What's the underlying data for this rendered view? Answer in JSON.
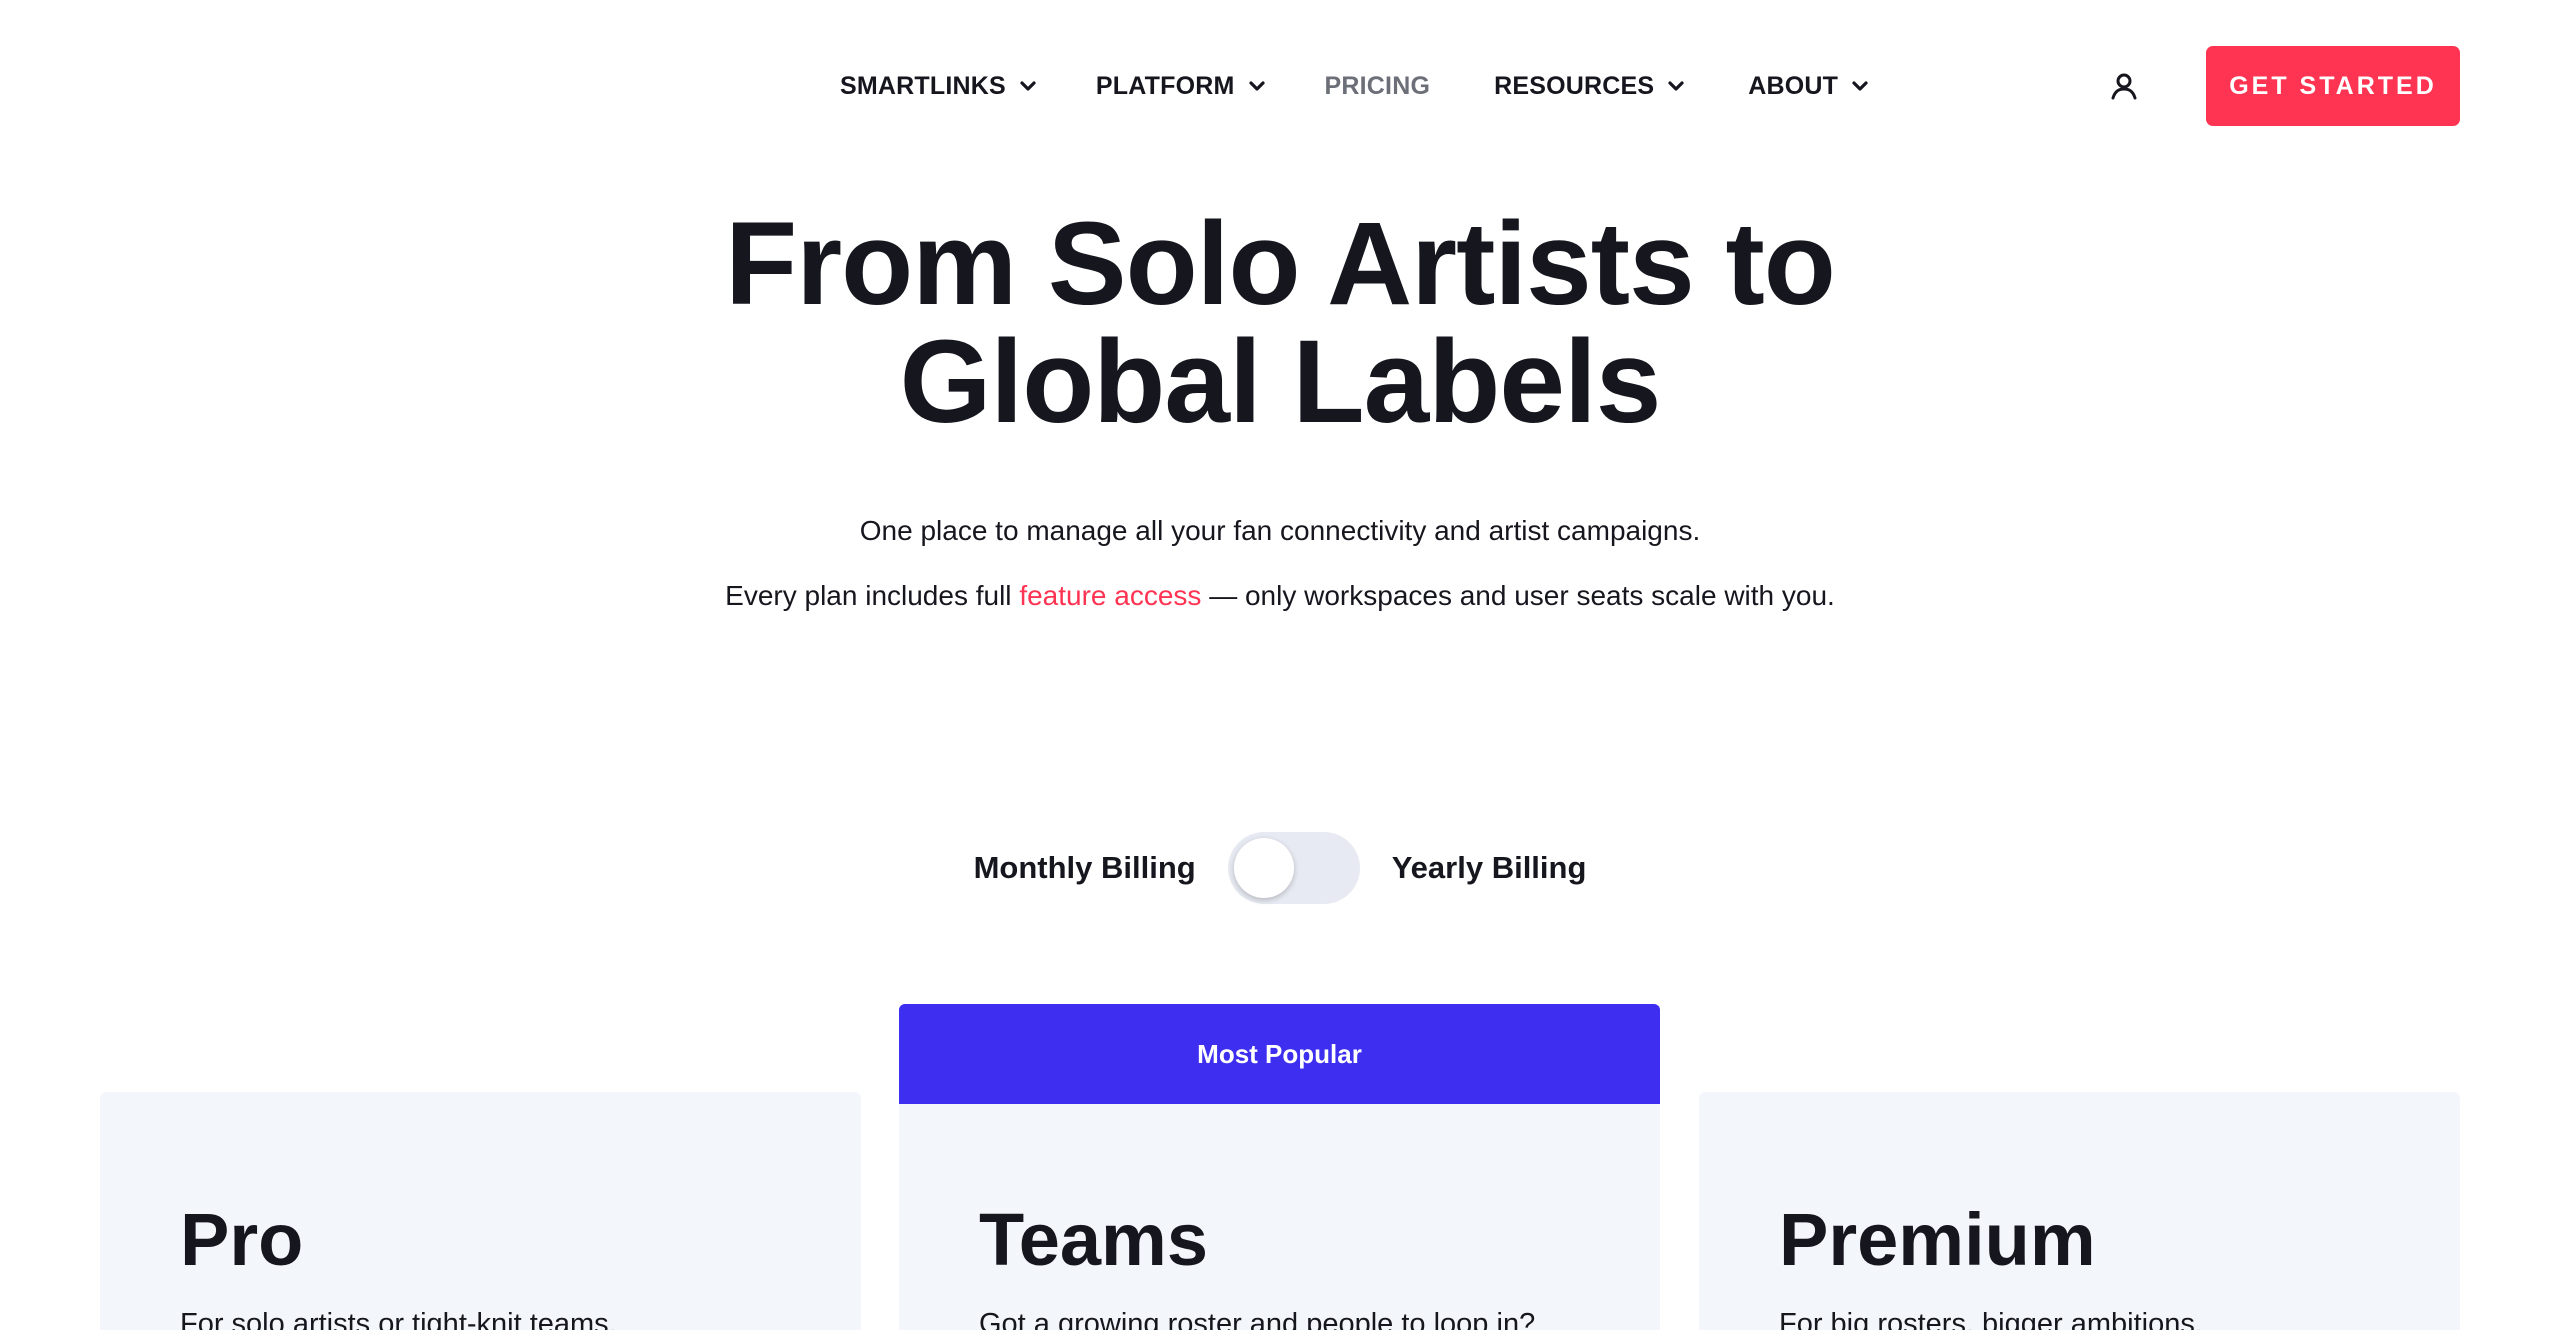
{
  "nav": {
    "items": [
      {
        "label": "SMARTLINKS",
        "has_dropdown": true
      },
      {
        "label": "PLATFORM",
        "has_dropdown": true
      },
      {
        "label": "PRICING",
        "has_dropdown": false,
        "active": true
      },
      {
        "label": "RESOURCES",
        "has_dropdown": true
      },
      {
        "label": "ABOUT",
        "has_dropdown": true
      }
    ],
    "user_icon": "user-icon",
    "cta_label": "GET STARTED"
  },
  "hero": {
    "title_line1": "From Solo Artists to",
    "title_line2": "Global Labels",
    "subtitle": "One place to manage all your fan connectivity and artist campaigns.",
    "plan_note_before": "Every plan includes full ",
    "plan_note_link": "feature access",
    "plan_note_after": " — only workspaces and user seats scale with you."
  },
  "billing": {
    "monthly_label": "Monthly Billing",
    "yearly_label": "Yearly Billing",
    "selected": "Monthly Billing"
  },
  "plans": [
    {
      "name": "Pro",
      "description": "For solo artists or tight-knit teams."
    },
    {
      "name": "Teams",
      "badge": "Most Popular",
      "description": "Got a growing roster and people to loop in?"
    },
    {
      "name": "Premium",
      "description": "For big rosters, bigger ambitions."
    }
  ],
  "colors": {
    "accent": "#ff3352",
    "popular": "#3d2ef0",
    "card_bg": "#f3f6fa",
    "text": "#16161e",
    "muted_nav": "#6d6f78",
    "toggle_track": "#e7eaf2"
  }
}
